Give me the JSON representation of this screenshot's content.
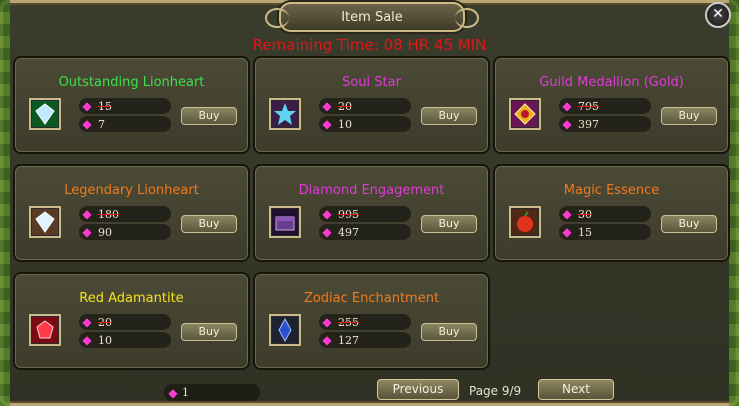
{
  "title": "Item Sale",
  "timer": "Remaining Time: 08 HR 45 MIN",
  "buy_label": "Buy",
  "items": [
    {
      "name": "Outstanding Lionheart",
      "color": "#3ee04a",
      "old_price": "15",
      "new_price": "7",
      "icon": "blue-diamond-icon"
    },
    {
      "name": "Soul Star",
      "color": "#e03ad8",
      "old_price": "20",
      "new_price": "10",
      "icon": "blue-star-icon"
    },
    {
      "name": "Guild Medallion (Gold)",
      "color": "#e03ad8",
      "old_price": "795",
      "new_price": "397",
      "icon": "gold-medallion-icon"
    },
    {
      "name": "Legendary Lionheart",
      "color": "#f07a1c",
      "old_price": "180",
      "new_price": "90",
      "icon": "diamond-icon"
    },
    {
      "name": "Diamond Engagement",
      "color": "#e03ad8",
      "old_price": "995",
      "new_price": "497",
      "icon": "purple-chest-icon"
    },
    {
      "name": "Magic Essence",
      "color": "#f07a1c",
      "old_price": "30",
      "new_price": "15",
      "icon": "red-fruit-icon"
    },
    {
      "name": "Red Adamantite",
      "color": "#f5e21c",
      "old_price": "20",
      "new_price": "10",
      "icon": "red-gem-icon"
    },
    {
      "name": "Zodiac Enchantment",
      "color": "#f07a1c",
      "old_price": "255",
      "new_price": "127",
      "icon": "blue-crystal-icon"
    }
  ],
  "currency_balance": "1",
  "pagination": {
    "previous": "Previous",
    "page": "Page 9/9",
    "next": "Next"
  }
}
